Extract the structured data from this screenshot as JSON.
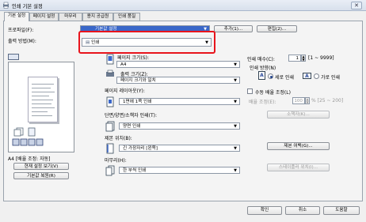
{
  "title": "인쇄 기본 설정",
  "tabs": [
    "기본 설정",
    "페이지 설정",
    "마무리",
    "용지 공급원",
    "인쇄 품질"
  ],
  "profile": {
    "label": "프로파일(F):",
    "value": "기본값 설정",
    "add_button": "추가(1)...",
    "edit_button": "편집(2)..."
  },
  "output": {
    "label": "출력 방법(M):",
    "value": "인쇄"
  },
  "preview": {
    "caption": "A4 [배율 조정: 자동]",
    "view_settings_button": "현재 설정 보기(V)",
    "restore_button": "기본값 복원(R)"
  },
  "page_size": {
    "label": "페이지 크기(S):",
    "value": "A4"
  },
  "output_size": {
    "label": "출력 크기(Z):",
    "value": "페이지 크기와 일치"
  },
  "layout": {
    "label": "페이지 레이아웃(Y):",
    "value": "1면에 1쪽 인쇄"
  },
  "duplex": {
    "label": "단면/양면/소책자 인쇄(T):",
    "value": "양면 인쇄"
  },
  "binding": {
    "label": "제본 위치(B):",
    "value": "긴 가장자리 [왼쪽]",
    "margin_button": "제본 여백(G)..."
  },
  "finishing": {
    "label": "마무리(H):",
    "value": "한 부씩 인쇄"
  },
  "copies": {
    "label": "인쇄 매수(C):",
    "value": "1",
    "range": "[1 ~ 9999]"
  },
  "orientation": {
    "label": "인쇄 방향(N)",
    "portrait": "세로 인쇄",
    "landscape": "가로 인쇄",
    "selected": "portrait"
  },
  "manual_scaling": {
    "label": "수동 배율 조정(L)",
    "scale_label": "배율 조정(E):",
    "scale_value": "100",
    "scale_range": "% [25 ~ 200]"
  },
  "booklet_button": "소책자(K)...",
  "staple_button": "스테이플러 위치(I)...",
  "footer": {
    "ok": "확인",
    "cancel": "취소",
    "help": "도움말"
  },
  "colors": {
    "accent": "#3a67c9",
    "highlight": "#e8141c"
  }
}
